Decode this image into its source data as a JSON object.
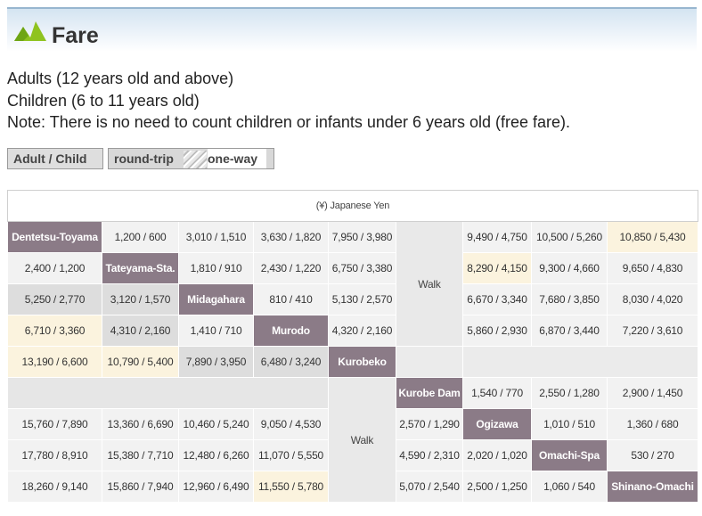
{
  "header": {
    "title": "Fare"
  },
  "notes": [
    "Adults (12 years old and above)",
    "Children (6 to 11 years old)",
    "Note: There is no need to count children or infants under 6 years old (free fare)."
  ],
  "legend": {
    "adult_child": "Adult / Child",
    "round_trip": "round-trip",
    "one_way": "one-way"
  },
  "table": {
    "caption": "(¥) Japanese Yen",
    "walk_label": "Walk",
    "stations": [
      "Dentetsu-Toyama",
      "Tateyama-Sta.",
      "Midagahara",
      "Murodo",
      "Kurobeko",
      "Kurobe Dam",
      "Ogizawa",
      "Omachi-Spa",
      "Shinano-Omachi"
    ],
    "rows": [
      [
        "Dentetsu-Toyama",
        "1,200 / 600",
        "3,010 / 1,510",
        "3,630 / 1,820",
        "7,950 / 3,980",
        "Walk",
        "9,490 / 4,750",
        "10,500 / 5,260",
        "10,850 / 5,430"
      ],
      [
        "2,400 / 1,200",
        "Tateyama-Sta.",
        "1,810 / 910",
        "2,430 / 1,220",
        "6,750 / 3,380",
        "8,290 / 4,150",
        "9,300 / 4,660",
        "9,650 / 4,830"
      ],
      [
        "5,250 / 2,770",
        "3,120 / 1,570",
        "Midagahara",
        "810 / 410",
        "5,130 / 2,570",
        "6,670 / 3,340",
        "7,680 / 3,850",
        "8,030 / 4,020"
      ],
      [
        "6,710 / 3,360",
        "4,310 / 2,160",
        "1,410 / 710",
        "Murodo",
        "4,320 / 2,160",
        "5,860 / 2,930",
        "6,870 / 3,440",
        "7,220 / 3,610"
      ],
      [
        "13,190 / 6,600",
        "10,790 / 5,400",
        "7,890 / 3,950",
        "6,480 / 3,240",
        "Kurobeko"
      ],
      [
        "Walk",
        "Kurobe Dam",
        "1,540 / 770",
        "2,550 / 1,280",
        "2,900 / 1,450"
      ],
      [
        "15,760 / 7,890",
        "13,360 / 6,690",
        "10,460 / 5,240",
        "9,050 / 4,530",
        "2,570 / 1,290",
        "Ogizawa",
        "1,010 / 510",
        "1,360 / 680"
      ],
      [
        "17,780 / 8,910",
        "15,380 / 7,710",
        "12,480 / 6,260",
        "11,070 / 5,550",
        "4,590 / 2,310",
        "2,020 / 1,020",
        "Omachi-Spa",
        "530 / 270"
      ],
      [
        "18,260 / 9,140",
        "15,860 / 7,940",
        "12,960 / 6,490",
        "11,550 / 5,780",
        "5,070 / 2,540",
        "2,500 / 1,250",
        "1,060 / 540",
        "Shinano-Omachi"
      ]
    ]
  },
  "colors": {
    "station_bg": "#8b7b87",
    "highlight_bg": "#fbf3de",
    "grey_bg": "#dddddd",
    "light_bg": "#f2f2f2",
    "header_accent": "#98b6cf",
    "mountain_green": "#8fc31f"
  },
  "icons": {
    "header": "mountain-icon"
  }
}
